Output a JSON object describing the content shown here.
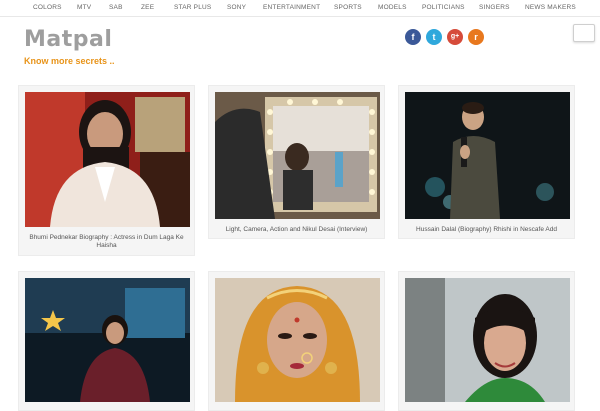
{
  "topnav": {
    "items": [
      "COLORS",
      "MTV",
      "SAB",
      "ZEE",
      "STAR PLUS",
      "SONY",
      "ENTERTAINMENT",
      "SPORTS",
      "MODELS",
      "POLITICIANS",
      "SINGERS",
      "NEWS MAKERS"
    ]
  },
  "header": {
    "logo": "Matpal",
    "tagline": "Know more secrets ..",
    "social": [
      {
        "name": "facebook-icon",
        "glyph": "f",
        "color": "#3b5998"
      },
      {
        "name": "twitter-icon",
        "glyph": "t",
        "color": "#2fa8dc"
      },
      {
        "name": "google-plus-icon",
        "glyph": "g+",
        "color": "#d64b3a"
      },
      {
        "name": "rss-icon",
        "glyph": "r",
        "color": "#e8781e"
      }
    ]
  },
  "posts": [
    {
      "title": "Bhumi Pednekar Biography : Actress in Dum Laga Ke Haisha"
    },
    {
      "title": "Light, Camera, Action and Nikul Desai (Interview)"
    },
    {
      "title": "Hussain Dalal (Biography) Rhishi in Nescafe Add"
    },
    {
      "title": ""
    },
    {
      "title": ""
    },
    {
      "title": ""
    }
  ]
}
